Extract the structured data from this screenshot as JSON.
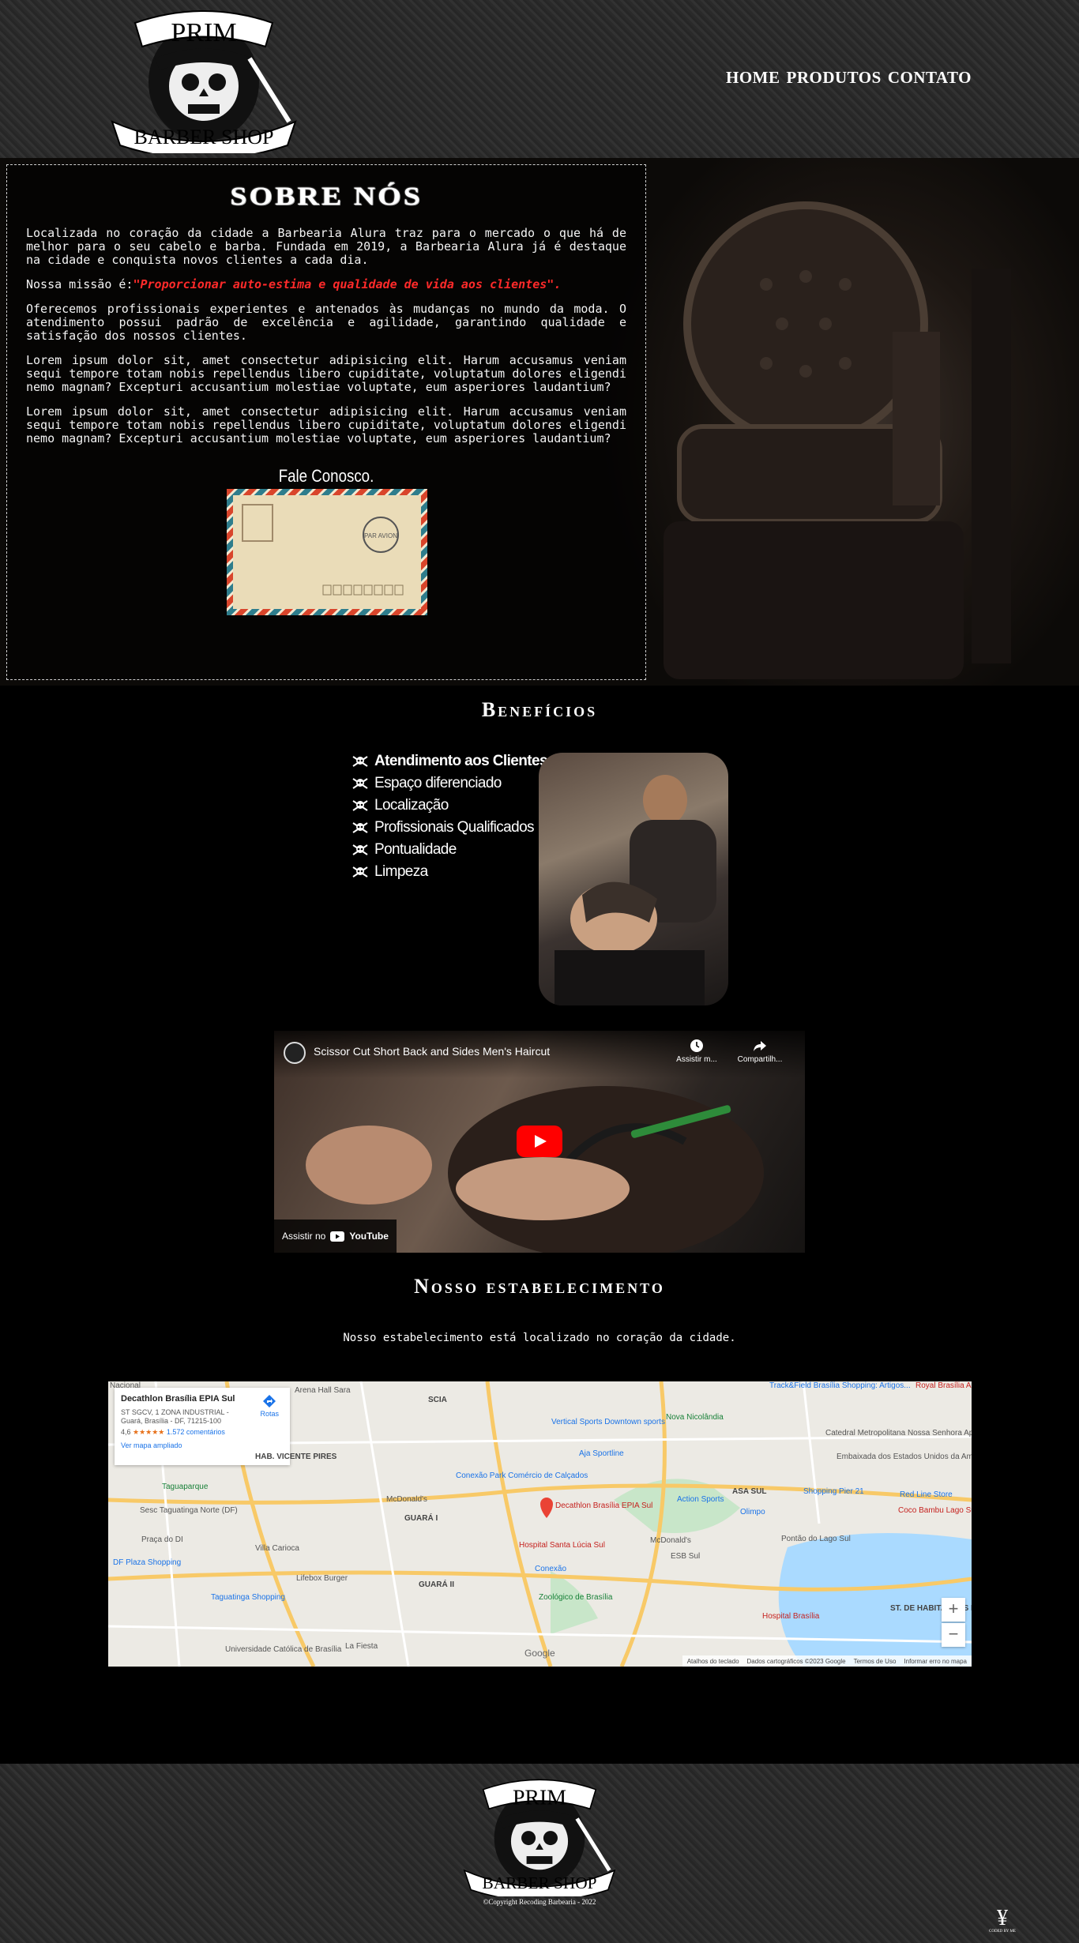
{
  "header": {
    "logo_top": "PRIM",
    "logo_bottom": "BARBER SHOP",
    "nav": [
      "HOME",
      "PRODUTOS",
      "CONTATO"
    ]
  },
  "sobre": {
    "title": "SOBRE NÓS",
    "p1": "Localizada no coração da cidade a Barbearia Alura traz para o mercado o que há de melhor para o seu cabelo e barba. Fundada em 2019, a Barbearia Alura já é destaque na cidade e conquista novos clientes a cada dia.",
    "mission_prefix": "Nossa missão é:",
    "mission_text": "\"Proporcionar auto-estima e qualidade de vida aos clientes\".",
    "p3": "Oferecemos profissionais experientes e antenados às mudanças no mundo da moda. O atendimento possui padrão de excelência e agilidade, garantindo qualidade e satisfação dos nossos clientes.",
    "p4": "Lorem ipsum dolor sit, amet consectetur adipisicing elit. Harum accusamus veniam sequi tempore totam nobis repellendus libero cupiditate, voluptatum dolores eligendi nemo magnam? Excepturi accusantium molestiae voluptate, eum asperiores laudantium?",
    "p5": "Lorem ipsum dolor sit, amet consectetur adipisicing elit. Harum accusamus veniam sequi tempore totam nobis repellendus libero cupiditate, voluptatum dolores eligendi nemo magnam? Excepturi accusantium molestiae voluptate, eum asperiores laudantium?",
    "fale": "Fale Conosco.",
    "envelope_stamp": "PAR AVION"
  },
  "beneficios": {
    "title": "Benefícios",
    "items": [
      "Atendimento aos Clientes",
      "Espaço diferenciado",
      "Localização",
      "Profissionais Qualificados",
      "Pontualidade",
      "Limpeza"
    ]
  },
  "video": {
    "title": "Scissor Cut Short Back and Sides Men's Haircut",
    "watch_later": "Assistir m...",
    "share": "Compartilh...",
    "watch_on": "Assistir no",
    "youtube": "YouTube"
  },
  "estabelecimento": {
    "title": "Nosso estabelecimento",
    "text": "Nosso estabelecimento está localizado no coração da cidade."
  },
  "map": {
    "place_name": "Decathlon Brasília EPIA Sul",
    "address": "ST SGCV, 1 ZONA INDUSTRIAL - Guará, Brasília - DF, 71215-100",
    "rating": "4,6",
    "stars": "★★★★★",
    "reviews": "1.572 comentários",
    "directions": "Rotas",
    "larger_map": "Ver mapa ampliado",
    "city": "Brasília",
    "labels": [
      "Nacional",
      "Arena Hall Sara",
      "SCIA",
      "Track&Field Brasília Shopping: Artigos...",
      "Royal Brasília Alvor",
      "Nova Nicolândia",
      "Vertical Sports Downtown sports",
      "Aja Sportline",
      "Catedral Metropolitana Nossa Senhora Aparecida",
      "Embaixada dos Estados Unidos da América",
      "HAB. VICENTE PIRES",
      "Taguaparque",
      "Conexão Park Comércio de Calçados",
      "McDonald's",
      "Action Sports",
      "ASA SUL",
      "Shopping Pier 21",
      "Red Line Store",
      "Sesc Taguatinga Norte (DF)",
      "GUARÁ I",
      "Decathlon Brasília EPIA Sul",
      "Olimpo",
      "Coco Bambu Lago Sul",
      "Praça do DI",
      "Villa Carioca",
      "Hospital Santa Lúcia Sul",
      "McDonald's",
      "Pontão do Lago Sul",
      "DF Plaza Shopping",
      "Lifebox Burger",
      "Conexão",
      "ESB Sul",
      "Taguatinga Shopping",
      "GUARÁ II",
      "Zoológico de Brasília",
      "Hospital Brasília",
      "ST. DE HABITAÇÕES INDIVIDUAIS SUL",
      "La Fiesta",
      "Universidade Católica de Brasília",
      "Google"
    ],
    "footer": [
      "Atalhos do teclado",
      "Dados cartográficos ©2023 Google",
      "Termos de Uso",
      "Informar erro no mapa"
    ],
    "zoom_in": "+",
    "zoom_out": "−"
  },
  "footer": {
    "logo_top": "PRIM",
    "logo_bottom": "BARBER SHOP",
    "copyright": "©Copyright Recoding Barbearia - 2022",
    "coded_symbol": "¥",
    "coded_text": "CODED BY ME"
  }
}
